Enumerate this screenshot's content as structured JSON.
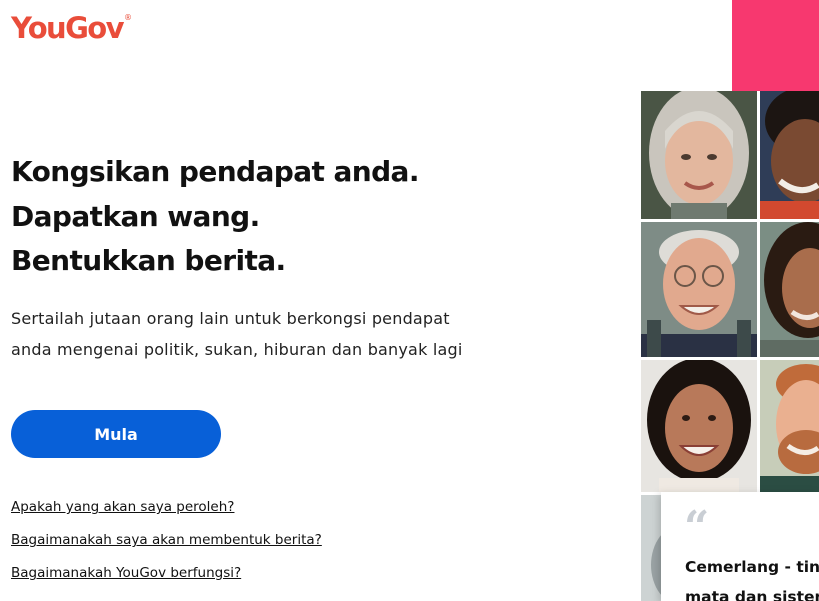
{
  "brand": {
    "name": "YouGov",
    "trademark": "®",
    "color": "#e94d3a"
  },
  "hero": {
    "headline_lines": [
      "Kongsikan pendapat anda.",
      "Dapatkan wang.",
      "Bentukkan berita."
    ],
    "intro": "Sertailah jutaan orang lain untuk berkongsi pendapat anda mengenai politik, sukan, hiburan dan banyak lagi",
    "cta_label": "Mula"
  },
  "links": [
    "Apakah yang akan saya peroleh?",
    "Bagaimanakah saya akan membentuk berita?",
    "Bagaimanakah YouGov berfungsi?"
  ],
  "testimonial": {
    "quote_icon": "quote-icon",
    "line1": "Cemerlang - tin",
    "line2": "mata dan sisten"
  },
  "colors": {
    "cta": "#0860d8",
    "accent_pink": "#f7386f"
  }
}
